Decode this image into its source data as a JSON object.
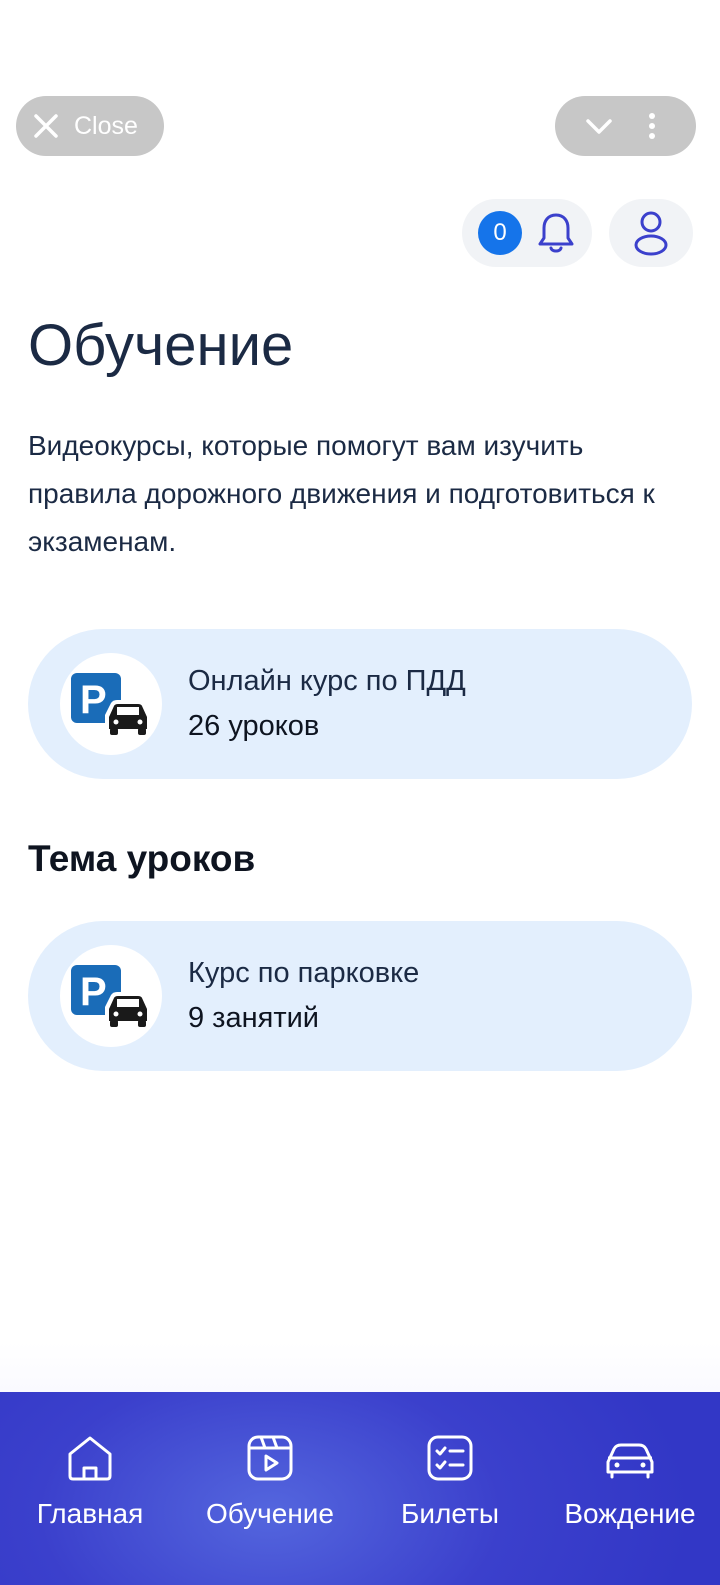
{
  "topbar": {
    "close_label": "Close"
  },
  "notifications": {
    "count": "0"
  },
  "page": {
    "title": "Обучение",
    "description": "Видеокурсы, которые помогут вам изучить правила дорожного движения и подготовиться к экзаменам."
  },
  "courses": [
    {
      "title": "Онлайн курс по ПДД",
      "subtitle": "26 уроков",
      "icon": "parking-car-icon"
    }
  ],
  "section": {
    "title": "Тема уроков"
  },
  "topics": [
    {
      "title": "Курс по парковке",
      "subtitle": "9 занятий",
      "icon": "parking-car-icon"
    }
  ],
  "nav": {
    "items": [
      {
        "label": "Главная",
        "icon": "home-icon"
      },
      {
        "label": "Обучение",
        "icon": "video-icon"
      },
      {
        "label": "Билеты",
        "icon": "checklist-icon"
      },
      {
        "label": "Вождение",
        "icon": "car-icon"
      }
    ]
  },
  "colors": {
    "accent": "#1574ea",
    "card_bg": "#e3effd",
    "nav_bg": "#3b40cc",
    "text": "#1b2a44"
  }
}
